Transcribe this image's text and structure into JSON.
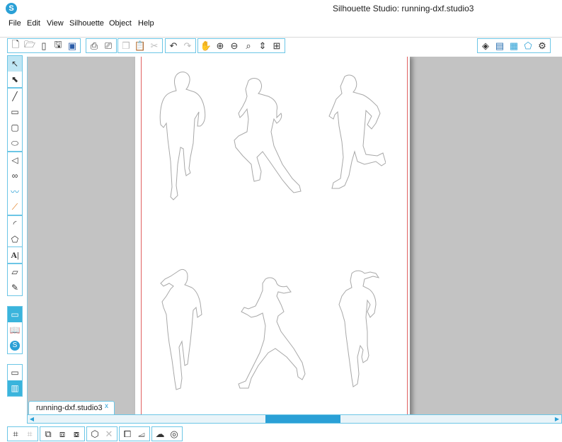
{
  "window": {
    "title": "Silhouette Studio: running-dxf.studio3",
    "logo_glyph": "S"
  },
  "menu": [
    "File",
    "Edit",
    "View",
    "Silhouette",
    "Object",
    "Help"
  ],
  "toolbar": {
    "groups": [
      [
        "new-document-icon",
        "open-folder-icon",
        "open-library-icon",
        "save-icon",
        "save-to-library-icon"
      ],
      [
        "print-icon",
        "print-and-cut-icon"
      ],
      [
        "copy-icon",
        "paste-icon",
        "cut-icon"
      ],
      [
        "undo-icon",
        "redo-icon"
      ],
      [
        "pan-hand-icon",
        "zoom-in-icon",
        "zoom-out-icon",
        "zoom-select-icon",
        "drag-zoom-icon",
        "fit-to-page-icon"
      ]
    ],
    "right_group": [
      "fill-bucket-icon",
      "line-style-icon",
      "fill-pattern-icon",
      "shape-pentagon-icon",
      "cut-settings-icon"
    ]
  },
  "left_tools": {
    "groups": [
      [
        "select-arrow-icon",
        "point-edit-icon"
      ],
      [
        "line-tool-icon",
        "rectangle-tool-icon",
        "rounded-rectangle-tool-icon",
        "ellipse-tool-icon"
      ],
      [
        "polygon-tool-icon",
        "curve-tool-icon",
        "freehand-tool-icon",
        "smooth-freehand-tool-icon"
      ],
      [
        "arc-tool-icon",
        "regular-polygon-tool-icon"
      ],
      [
        "text-tool-icon"
      ],
      [
        "eraser-tool-icon",
        "knife-tool-icon"
      ],
      [
        "design-page-view-icon",
        "library-view-icon",
        "silhouette-store-icon"
      ],
      [
        "single-panel-icon",
        "split-panel-icon"
      ]
    ]
  },
  "document": {
    "tab_label": "running-dxf.studio3",
    "tab_close": "x"
  },
  "canvas": {
    "runners": [
      "runner-man-front-1",
      "runner-man-side-2",
      "runner-man-front-3",
      "runner-woman-back-4",
      "runner-woman-side-5",
      "runner-woman-front-6"
    ]
  },
  "bottom_toolbar": [
    "group-icon",
    "ungroup-icon",
    "compound-path-icon",
    "release-compound-icon",
    "weld-icon",
    "subdivide-icon",
    "bring-forward-icon",
    "send-backward-icon",
    "offset-icon",
    "trace-icon"
  ],
  "colors": {
    "accent": "#2aa0d6",
    "border": "#6cc6e6",
    "workarea": "#c3c3c3",
    "cut_line": "#e06060",
    "outline": "#a8a8a8"
  }
}
